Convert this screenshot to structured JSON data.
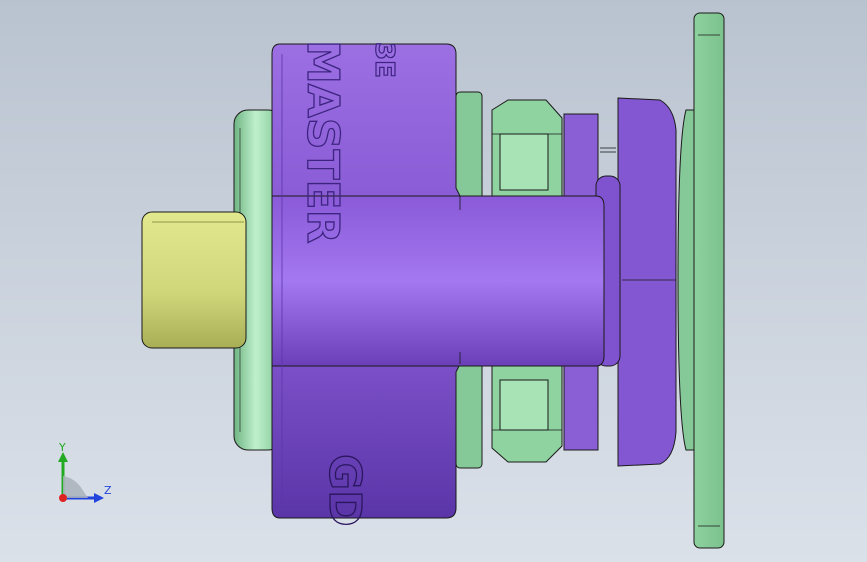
{
  "viewport": {
    "background_top": "#b9c3cf",
    "background_bottom": "#dbe1e9"
  },
  "model": {
    "colors": {
      "purple": "#9966dd",
      "purple_dark": "#5a35a8",
      "green": "#88cc99",
      "green_dark": "#4f9a63",
      "yellow": "#cfd67a",
      "edge": "#1a1a1a"
    },
    "engravings": {
      "top_band_text": "MASTER",
      "top_band_fragment": "3E",
      "bottom_band_text": "GD"
    }
  },
  "triad": {
    "icon": "view-orientation-triad-icon",
    "y_label": "Y",
    "z_label": "Z",
    "y_color": "#22aa22",
    "z_color": "#2244dd",
    "x_color": "#dd2222"
  }
}
